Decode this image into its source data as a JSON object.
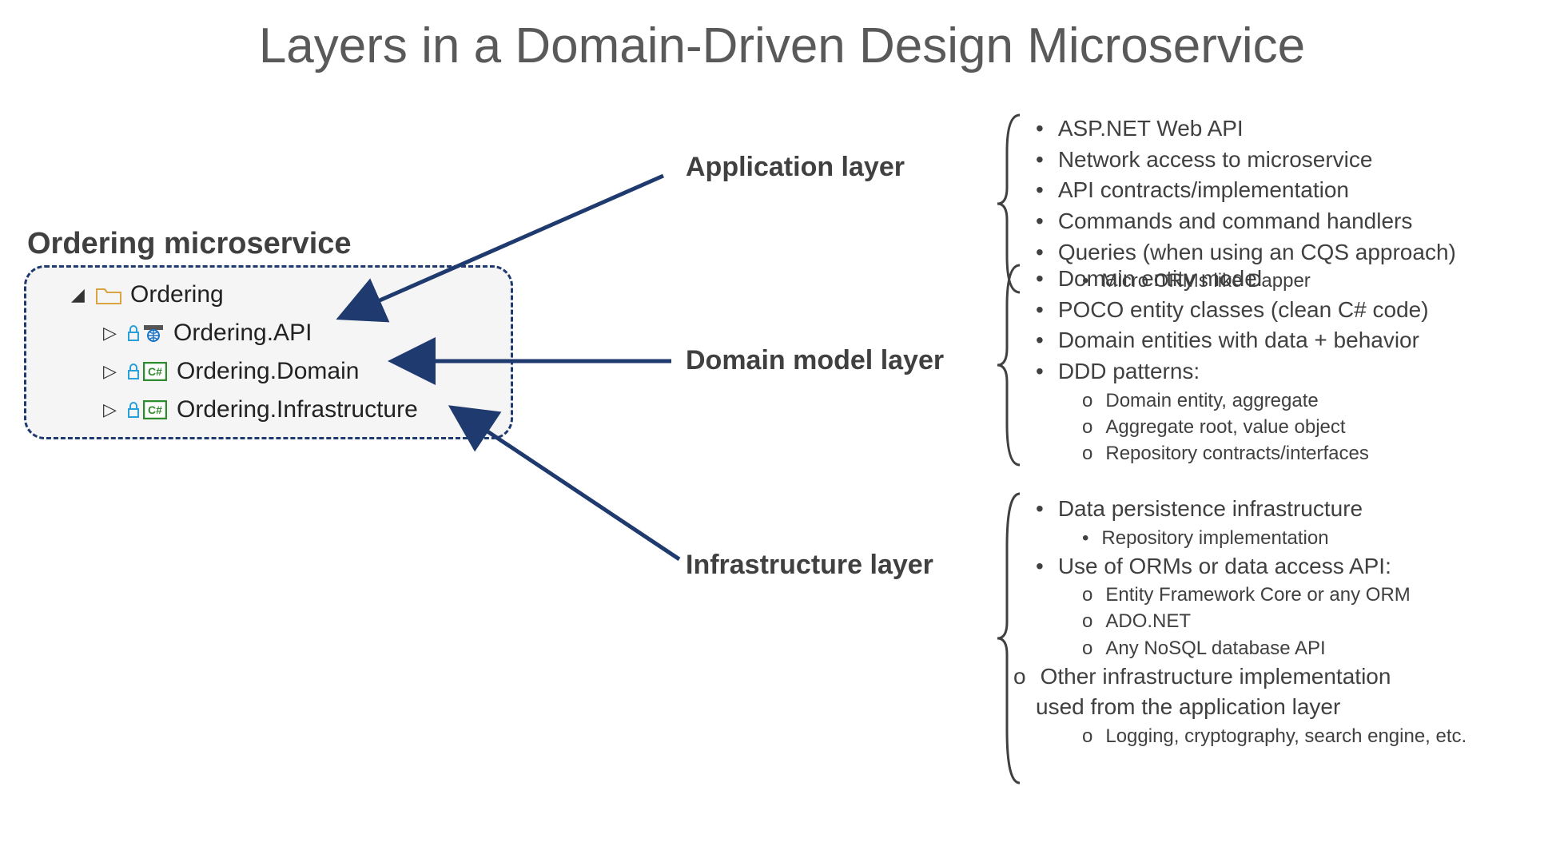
{
  "title": "Layers in a Domain-Driven Design Microservice",
  "subtitle": "Ordering microservice",
  "explorer": {
    "root": "Ordering",
    "children": [
      "Ordering.API",
      "Ordering.Domain",
      "Ordering.Infrastructure"
    ]
  },
  "layers": {
    "app": {
      "heading": "Application layer"
    },
    "domain": {
      "heading": "Domain model layer"
    },
    "infra": {
      "heading": "Infrastructure layer"
    }
  },
  "bullets": {
    "app": {
      "items": [
        "ASP.NET Web API",
        "Network access to microservice",
        "API contracts/implementation",
        "Commands and command handlers",
        "Queries (when using an CQS approach)"
      ],
      "sub": [
        {
          "style": "dot",
          "text": "Micro ORMs like Dapper"
        }
      ]
    },
    "domain": {
      "items": [
        "Domain entity model",
        "POCO entity classes (clean C# code)",
        "Domain entities with data + behavior",
        "DDD patterns:"
      ],
      "sub": [
        {
          "style": "circ",
          "text": "Domain entity, aggregate"
        },
        {
          "style": "circ",
          "text": "Aggregate root, value object"
        },
        {
          "style": "circ",
          "text": "Repository contracts/interfaces"
        }
      ]
    },
    "infra": {
      "items1": [
        "Data persistence infrastructure"
      ],
      "sub1": [
        {
          "style": "dot",
          "text": "Repository implementation"
        }
      ],
      "items2": [
        "Use of ORMs or data access API:"
      ],
      "sub2": [
        {
          "style": "circ",
          "text": "Entity Framework Core or any ORM"
        },
        {
          "style": "circ",
          "text": "ADO.NET"
        },
        {
          "style": "circ",
          "text": "Any NoSQL database API"
        }
      ],
      "tail_line1": "Other infrastructure implementation",
      "tail_line2": "used from the application layer",
      "sub3": [
        {
          "style": "circ",
          "text": "Logging, cryptography, search engine, etc."
        }
      ]
    }
  },
  "colors": {
    "arrow": "#1f3a6e",
    "brace": "#404040"
  }
}
